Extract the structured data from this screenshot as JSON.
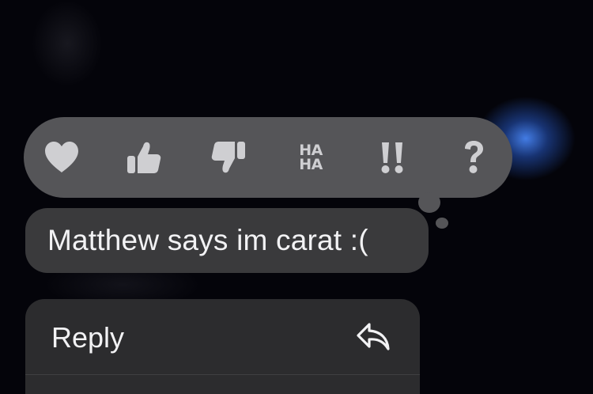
{
  "tapbacks": [
    {
      "name": "heart",
      "icon": "heart-icon"
    },
    {
      "name": "thumbs-up",
      "icon": "thumbs-up-icon"
    },
    {
      "name": "thumbs-down",
      "icon": "thumbs-down-icon"
    },
    {
      "name": "haha",
      "icon": "haha-icon",
      "lines": [
        "HA",
        "HA"
      ]
    },
    {
      "name": "emphasize",
      "icon": "double-exclamation-icon",
      "label": "‼"
    },
    {
      "name": "question",
      "icon": "question-mark-icon",
      "label": "?"
    }
  ],
  "message": {
    "text": "Matthew says im carat :("
  },
  "menu": {
    "items": [
      {
        "label": "Reply",
        "icon": "reply-arrow-icon"
      }
    ]
  },
  "colors": {
    "background": "#04040a",
    "tapback_bar": "#555558",
    "tapback_icon": "#cfcfd2",
    "bubble": "#3a3a3c",
    "menu": "#2c2c2e",
    "glow": "#4a82f0"
  }
}
